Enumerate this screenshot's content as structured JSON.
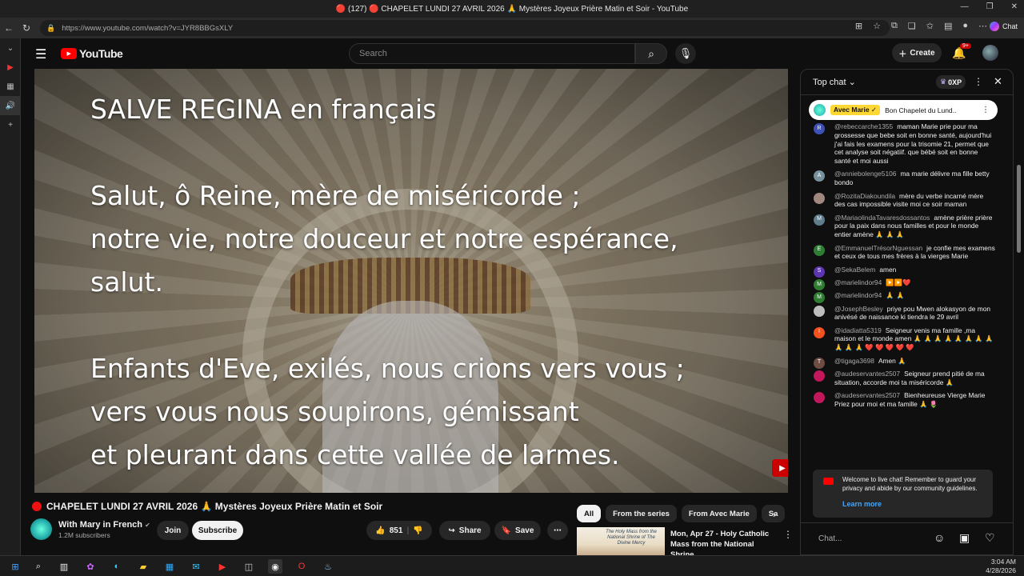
{
  "browser": {
    "window_title": "🔴 (127) 🔴 CHAPELET LUNDI 27 AVRIL 2026 🙏 Mystères Joyeux Prière Matin et Soir - YouTube",
    "url": "https://www.youtube.com/watch?v=JYR8BBGsXLY",
    "copilot_label": "Chat"
  },
  "header": {
    "logo_text": "YouTube",
    "search_placeholder": "Search",
    "create_label": "Create",
    "notification_count": "9+"
  },
  "video": {
    "lyrics": [
      "SALVE REGINA en français",
      "",
      "Salut, ô Reine, mère de miséricorde ;",
      "notre vie, notre douceur et notre espérance,",
      "salut.",
      "",
      "Enfants d'Eve, exilés, nous crions vers vous ;",
      "vers vous nous soupirons, gémissant",
      "et pleurant dans cette vallée de larmes."
    ],
    "title": "CHAPELET LUNDI 27 AVRIL 2026 🙏 Mystères Joyeux Prière Matin et Soir"
  },
  "channel": {
    "name": "With Mary in French",
    "verified_mark": "✔",
    "subscribers": "1.2M subscribers",
    "join_label": "Join",
    "subscribe_label": "Subscribe"
  },
  "actions": {
    "likes": "851",
    "share_label": "Share",
    "save_label": "Save"
  },
  "chips": [
    "All",
    "From the series",
    "From Avec Marie",
    "Sa"
  ],
  "recommendation": {
    "thumb_text": "The Holy Mass from the National Shrine of The Divine Mercy",
    "title": "Mon, Apr 27 - Holy Catholic Mass from the National Shrine..."
  },
  "chat": {
    "header_label": "Top chat",
    "xp_label": "0XP",
    "pinned_author": "Avec Marie ✓",
    "pinned_text": "Bon Chapelet du Lund...",
    "messages": [
      {
        "initial": "R",
        "color": "#3f51b5",
        "author": "@rebeccarche1355",
        "text": "maman Marie prie pour ma grossesse que bebe soit en bonne santé, aujourd'hui j'ai fais les examens pour la trisomie 21, permet que cet analyse soit négatiif. que bébé soit en bonne santé et moi aussi"
      },
      {
        "initial": "A",
        "color": "#78909c",
        "author": "@anniebolenge5106",
        "text": "ma marie délivre ma fille betty bondo"
      },
      {
        "initial": "",
        "color": "#a1887f",
        "author": "@RozitaDiakoundila",
        "text": "mère du verbe incarné mère des cas impossible visite moi ce soir maman"
      },
      {
        "initial": "M",
        "color": "#607d8b",
        "author": "@MariaolindaTavaresdossantos",
        "text": "amène prière prière pour la paix dans nous familles et pour le monde entier amène 🙏 🙏 🙏"
      },
      {
        "initial": "E",
        "color": "#2e7d32",
        "author": "@EmmanuelTrésorNguessan",
        "text": "je confie mes examens et ceux de tous mes frères à la vierges Marie"
      },
      {
        "initial": "S",
        "color": "#5e35b1",
        "author": "@SekaBelem",
        "text": "amen"
      },
      {
        "initial": "M",
        "color": "#2e7d32",
        "author": "@marielindor94",
        "text": "▶️▶️❤️"
      },
      {
        "initial": "M",
        "color": "#2e7d32",
        "author": "@marielindor94",
        "text": "🙏 🙏"
      },
      {
        "initial": "",
        "color": "#bdbdbd",
        "author": "@JosephBesley",
        "text": "priye pou Mwen alokasyon de mon anivésé de naissance ki tiendra le 29 avril"
      },
      {
        "initial": "I",
        "color": "#f4511e",
        "author": "@idadiatta5319",
        "text": "Seigneur venis ma famille ,ma maison et le monde amen 🙏 🙏 🙏 🙏 🙏 🙏 🙏 🙏 🙏 🙏 🙏 ❤️ ❤️ ❤️ ❤️ ❤️"
      },
      {
        "initial": "T",
        "color": "#6d4c41",
        "author": "@tigaga3698",
        "text": "Amen 🙏"
      },
      {
        "initial": "",
        "color": "#c2185b",
        "author": "@audeservantes2507",
        "text": "Seigneur prend pitié de ma situation, accorde moi ta miséricorde 🙏"
      },
      {
        "initial": "",
        "color": "#c2185b",
        "author": "@audeservantes2507",
        "text": "Bienheureuse Vierge Marie Priez pour moi et ma famille 🙏 🌷"
      }
    ],
    "welcome_text": "Welcome to live chat! Remember to guard your privacy and abide by our community guidelines.",
    "learn_more": "Learn more",
    "input_placeholder": "Chat..."
  },
  "taskbar": {
    "time": "3:04 AM",
    "date": "4/28/2026"
  }
}
